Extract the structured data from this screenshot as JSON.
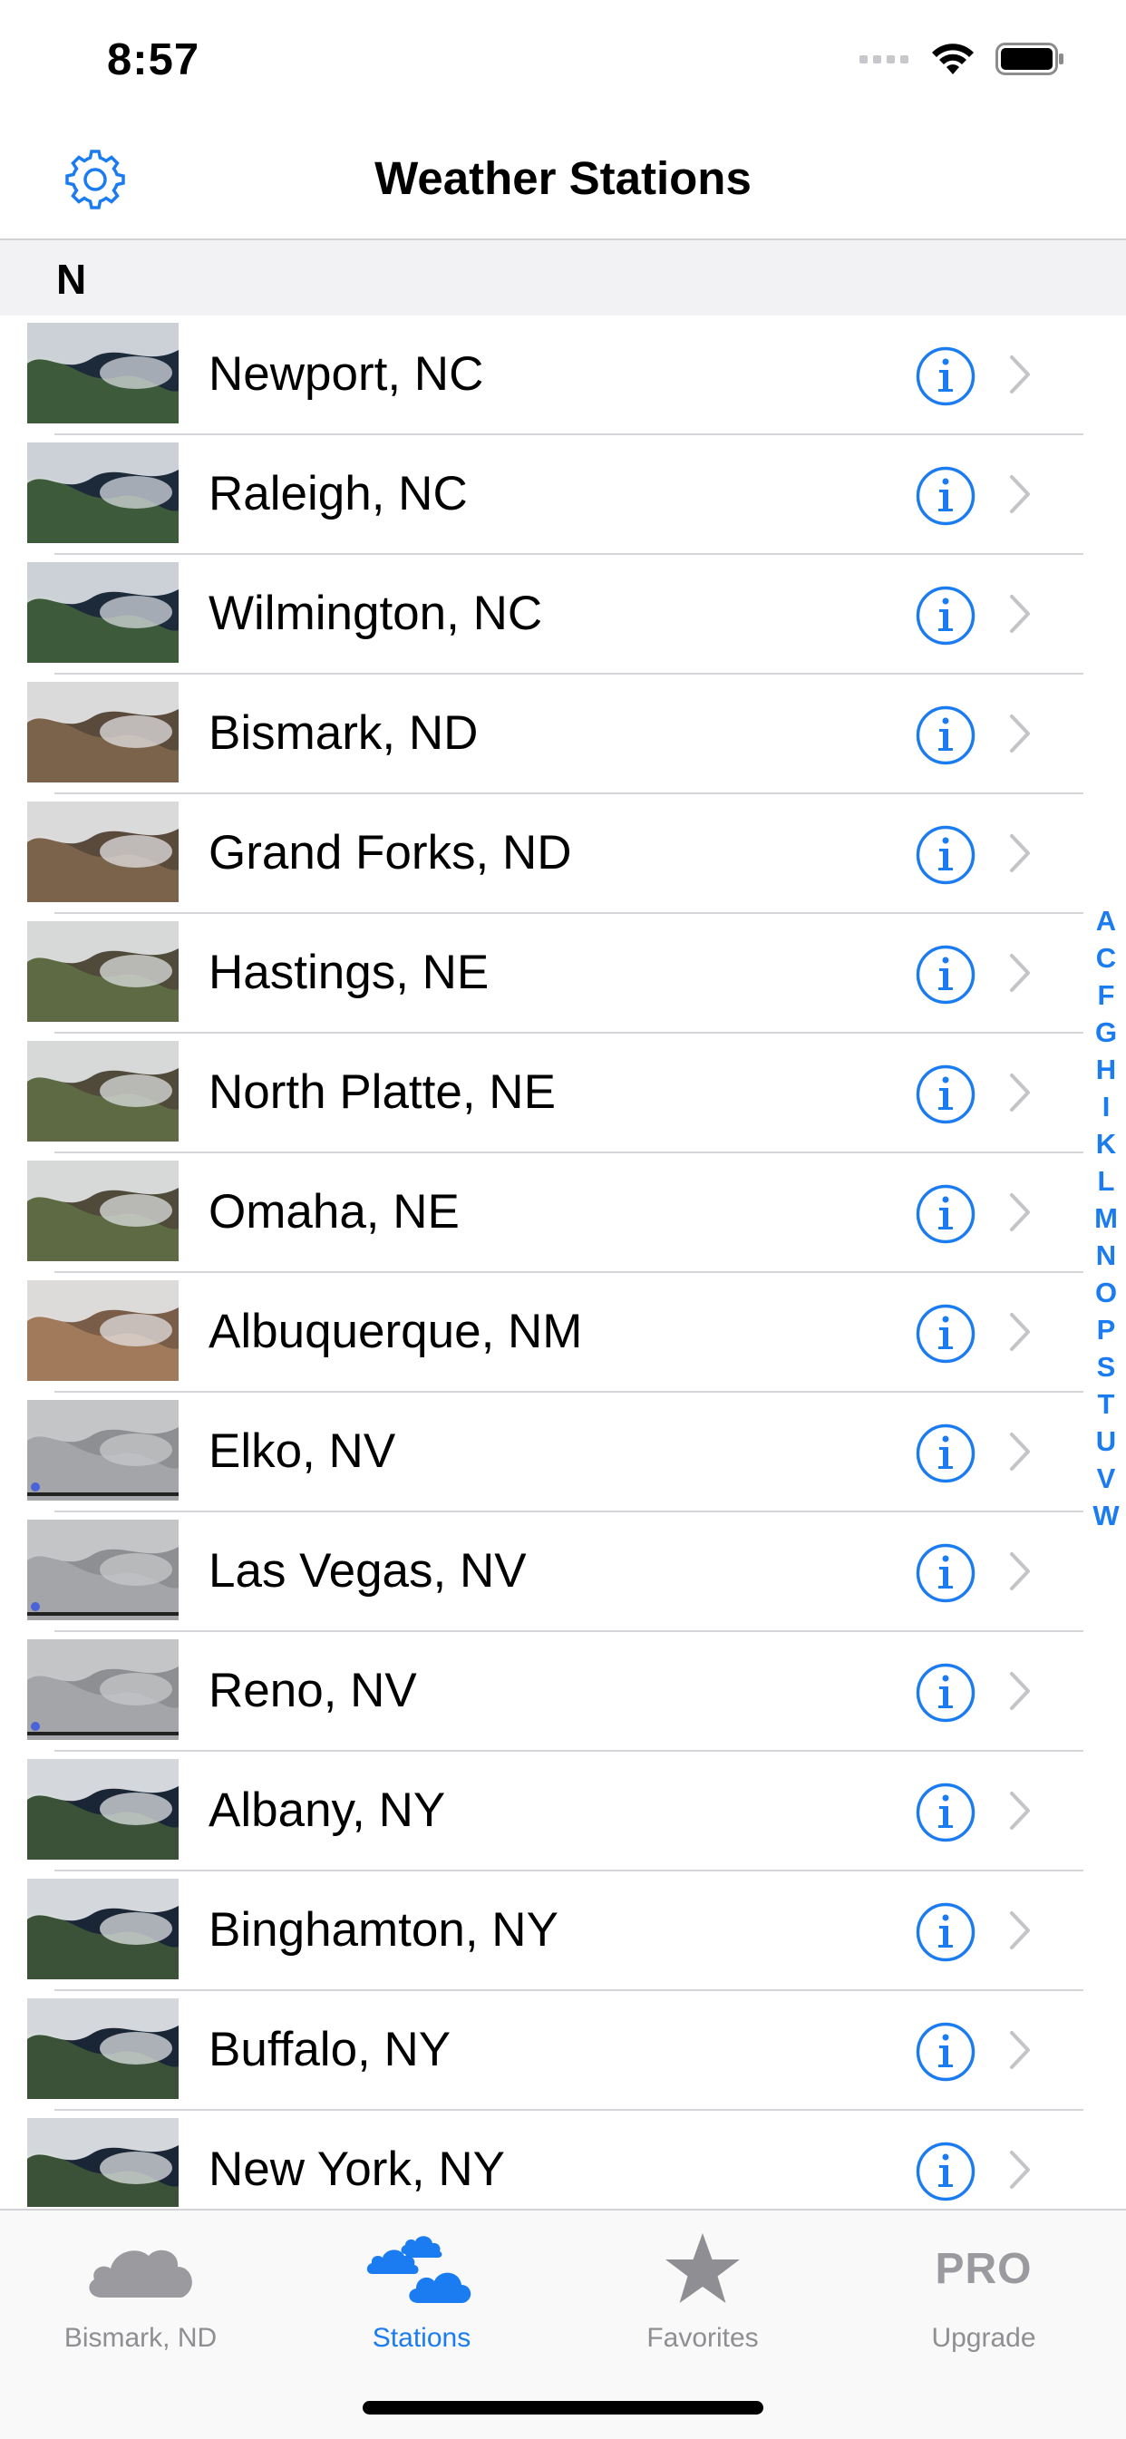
{
  "status_bar": {
    "time": "8:57"
  },
  "nav": {
    "title": "Weather Stations"
  },
  "section": {
    "letter": "N"
  },
  "colors": {
    "accent": "#1a7cf0",
    "inactive": "#8e8e93"
  },
  "rows": [
    {
      "label": "Newport, NC",
      "thumb": "east"
    },
    {
      "label": "Raleigh, NC",
      "thumb": "east"
    },
    {
      "label": "Wilmington, NC",
      "thumb": "east"
    },
    {
      "label": "Bismark, ND",
      "thumb": "plains"
    },
    {
      "label": "Grand Forks, ND",
      "thumb": "plains"
    },
    {
      "label": "Hastings, NE",
      "thumb": "plains2"
    },
    {
      "label": "North Platte, NE",
      "thumb": "plains2"
    },
    {
      "label": "Omaha, NE",
      "thumb": "plains2"
    },
    {
      "label": "Albuquerque, NM",
      "thumb": "southwest"
    },
    {
      "label": "Elko, NV",
      "thumb": "gray"
    },
    {
      "label": "Las Vegas, NV",
      "thumb": "gray"
    },
    {
      "label": "Reno, NV",
      "thumb": "gray"
    },
    {
      "label": "Albany, NY",
      "thumb": "northeast"
    },
    {
      "label": "Binghamton, NY",
      "thumb": "northeast"
    },
    {
      "label": "Buffalo, NY",
      "thumb": "northeast"
    },
    {
      "label": "New York, NY",
      "thumb": "northeast"
    }
  ],
  "index_letters": [
    "A",
    "C",
    "F",
    "G",
    "H",
    "I",
    "K",
    "L",
    "M",
    "N",
    "O",
    "P",
    "S",
    "T",
    "U",
    "V",
    "W"
  ],
  "tabs": [
    {
      "label": "Bismark, ND",
      "icon": "cloud-icon",
      "active": false
    },
    {
      "label": "Stations",
      "icon": "clouds-icon",
      "active": true
    },
    {
      "label": "Favorites",
      "icon": "star-icon",
      "active": false
    },
    {
      "label": "Upgrade",
      "icon": "pro-icon",
      "icon_text": "PRO",
      "active": false
    }
  ]
}
